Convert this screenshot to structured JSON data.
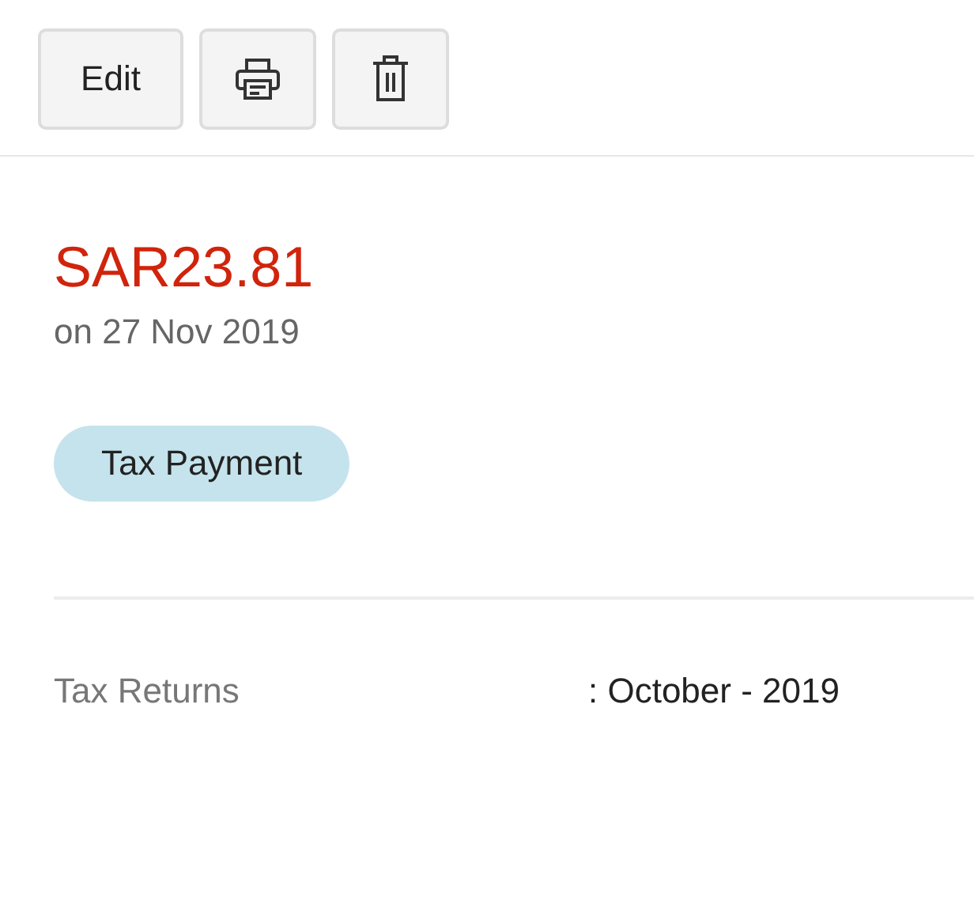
{
  "toolbar": {
    "buttons": [
      {
        "kind": "text",
        "label": "Edit"
      },
      {
        "kind": "print"
      },
      {
        "kind": "delete"
      }
    ]
  },
  "amount": "SAR23.81",
  "date": "on 27 Nov 2019",
  "tag": "Tax Payment",
  "details": [
    {
      "label": "Tax Returns",
      "value": ": October - 2019"
    }
  ]
}
